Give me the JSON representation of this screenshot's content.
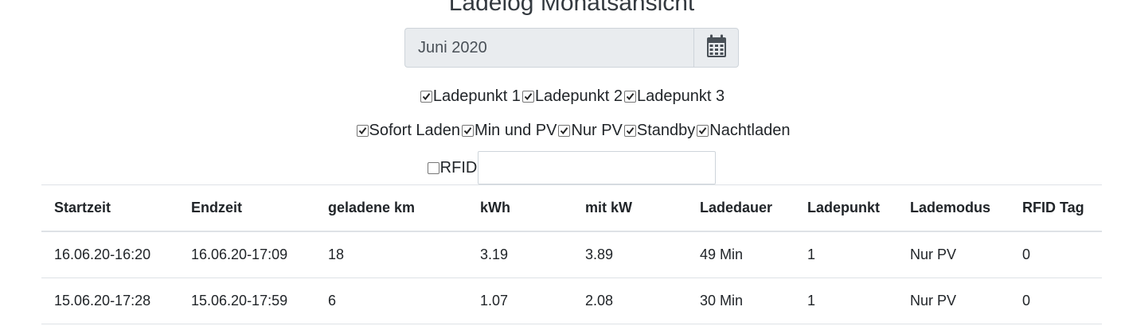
{
  "page": {
    "title": "Ladelog Monatsansicht"
  },
  "month_picker": {
    "value": "Juni 2020",
    "button_icon": "calendar-icon"
  },
  "filters": {
    "ladepunkte": [
      {
        "label": "Ladepunkt 1",
        "checked": true
      },
      {
        "label": "Ladepunkt 2",
        "checked": true
      },
      {
        "label": "Ladepunkt 3",
        "checked": true
      }
    ],
    "modes": [
      {
        "label": "Sofort Laden",
        "checked": true
      },
      {
        "label": "Min und PV",
        "checked": true
      },
      {
        "label": "Nur PV",
        "checked": true
      },
      {
        "label": "Standby",
        "checked": true
      },
      {
        "label": "Nachtladen",
        "checked": true
      }
    ],
    "rfid": {
      "label": "RFID",
      "checked": false,
      "value": ""
    }
  },
  "table": {
    "headers": [
      "Startzeit",
      "Endzeit",
      "geladene km",
      "kWh",
      "mit kW",
      "Ladedauer",
      "Ladepunkt",
      "Lademodus",
      "RFID Tag"
    ],
    "rows": [
      [
        "16.06.20-16:20",
        "16.06.20-17:09",
        "18",
        "3.19",
        "3.89",
        "49 Min",
        "1",
        "Nur PV",
        "0"
      ],
      [
        "15.06.20-17:28",
        "15.06.20-17:59",
        "6",
        "1.07",
        "2.08",
        "30 Min",
        "1",
        "Nur PV",
        "0"
      ]
    ]
  },
  "colors": {
    "input_bg": "#e9ecef",
    "border": "#ced4da",
    "table_border": "#dee2e6",
    "text": "#212529"
  }
}
